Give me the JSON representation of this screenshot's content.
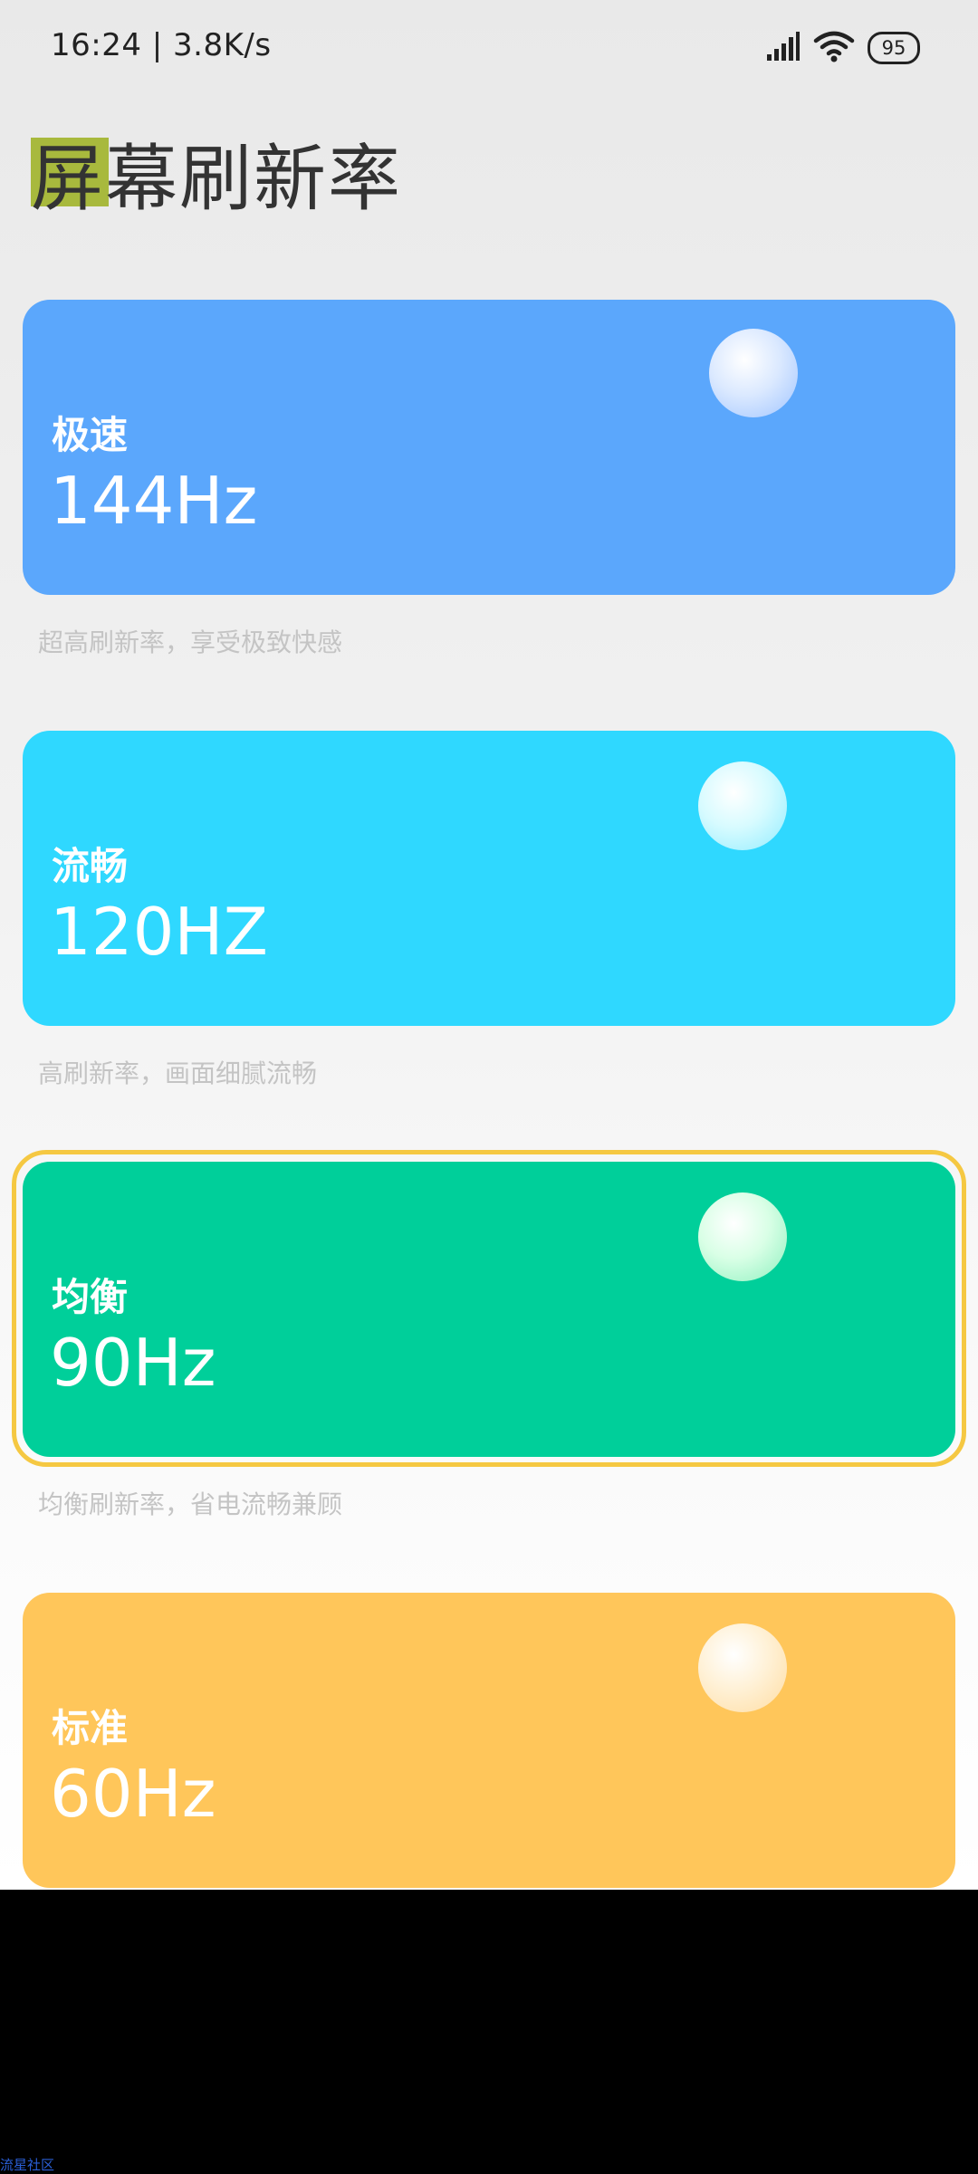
{
  "status_bar": {
    "time_speed": "16:24 | 3.8K/s",
    "battery": "95",
    "icons": [
      "signal-icon",
      "wifi-icon",
      "battery-icon"
    ]
  },
  "page": {
    "title": "屏幕刷新率"
  },
  "modes": [
    {
      "name": "极速",
      "rate": "144Hz",
      "description": "超高刷新率，享受极致快感",
      "color": "#5ba7fc",
      "selected": false
    },
    {
      "name": "流畅",
      "rate": "120HZ",
      "description": "高刷新率，画面细腻流畅",
      "color": "#2fd8ff",
      "selected": false
    },
    {
      "name": "均衡",
      "rate": "90Hz",
      "description": "均衡刷新率，省电流畅兼顾",
      "color": "#00cf9a",
      "selected": true
    },
    {
      "name": "标准",
      "rate": "60Hz",
      "description": "",
      "color": "#ffc65a",
      "selected": false
    }
  ],
  "colors": {
    "selection_ring": "#f5c842"
  },
  "watermark": "流星社区"
}
